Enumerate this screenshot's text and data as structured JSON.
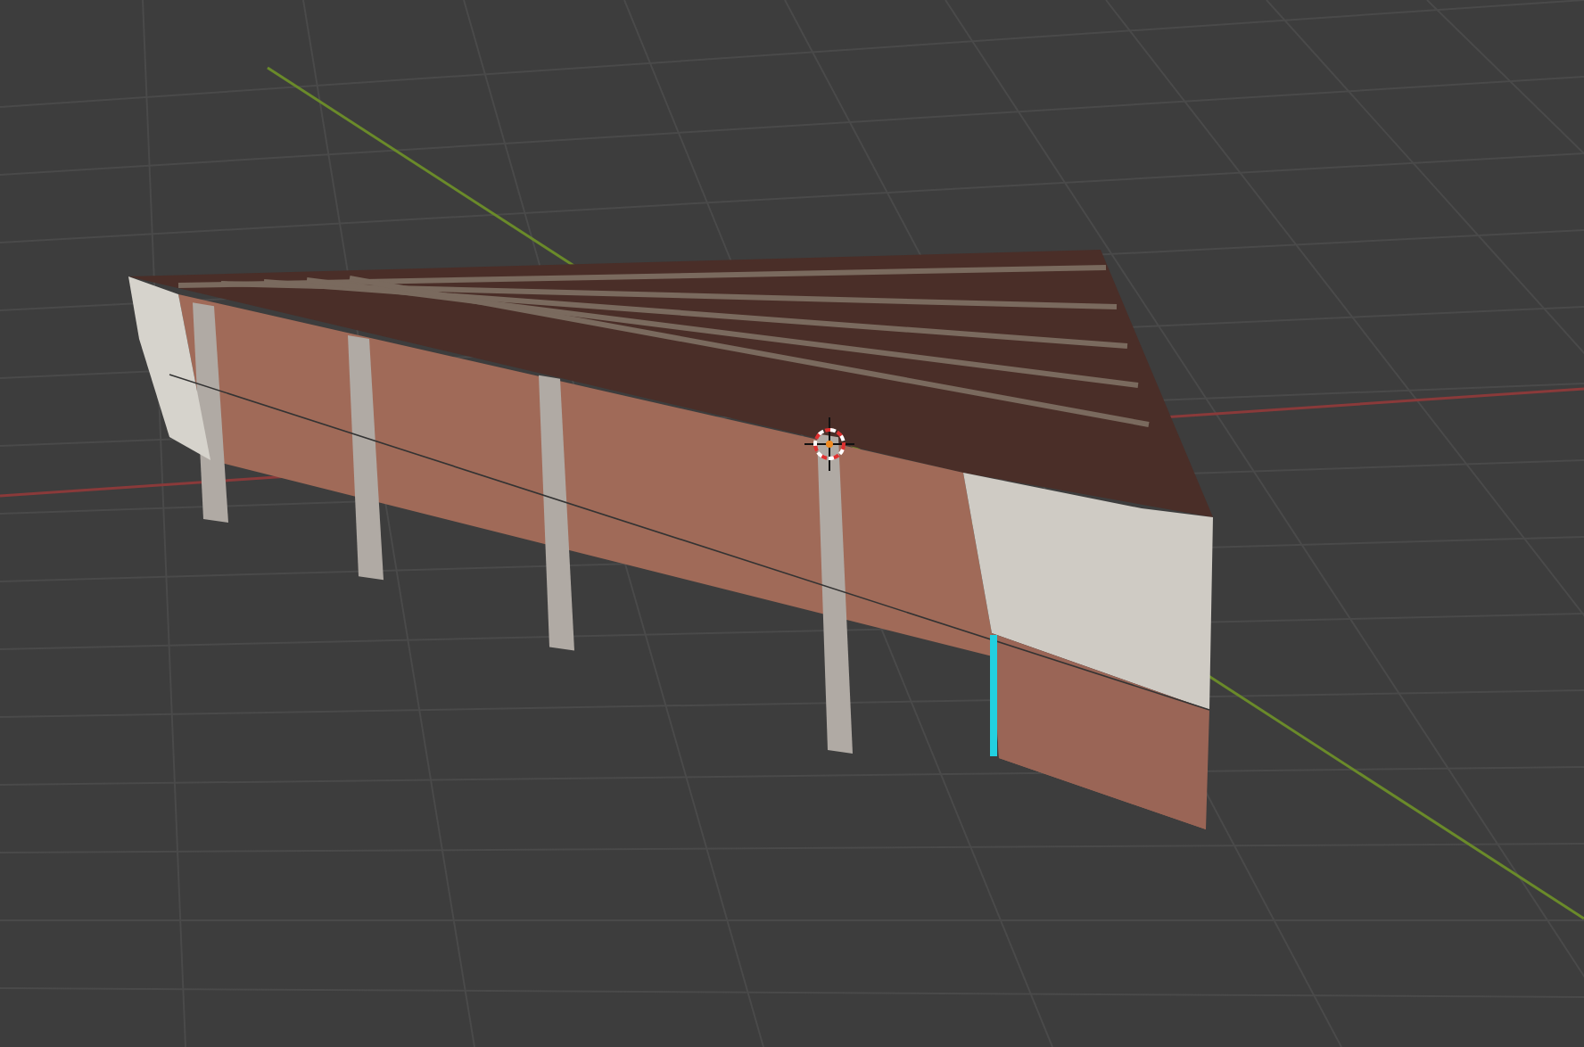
{
  "viewport": {
    "grid": true,
    "x_axis": true,
    "y_axis": true,
    "objects": [
      {
        "kind": "wedge",
        "edge_selected": true
      }
    ],
    "cursor": true
  }
}
